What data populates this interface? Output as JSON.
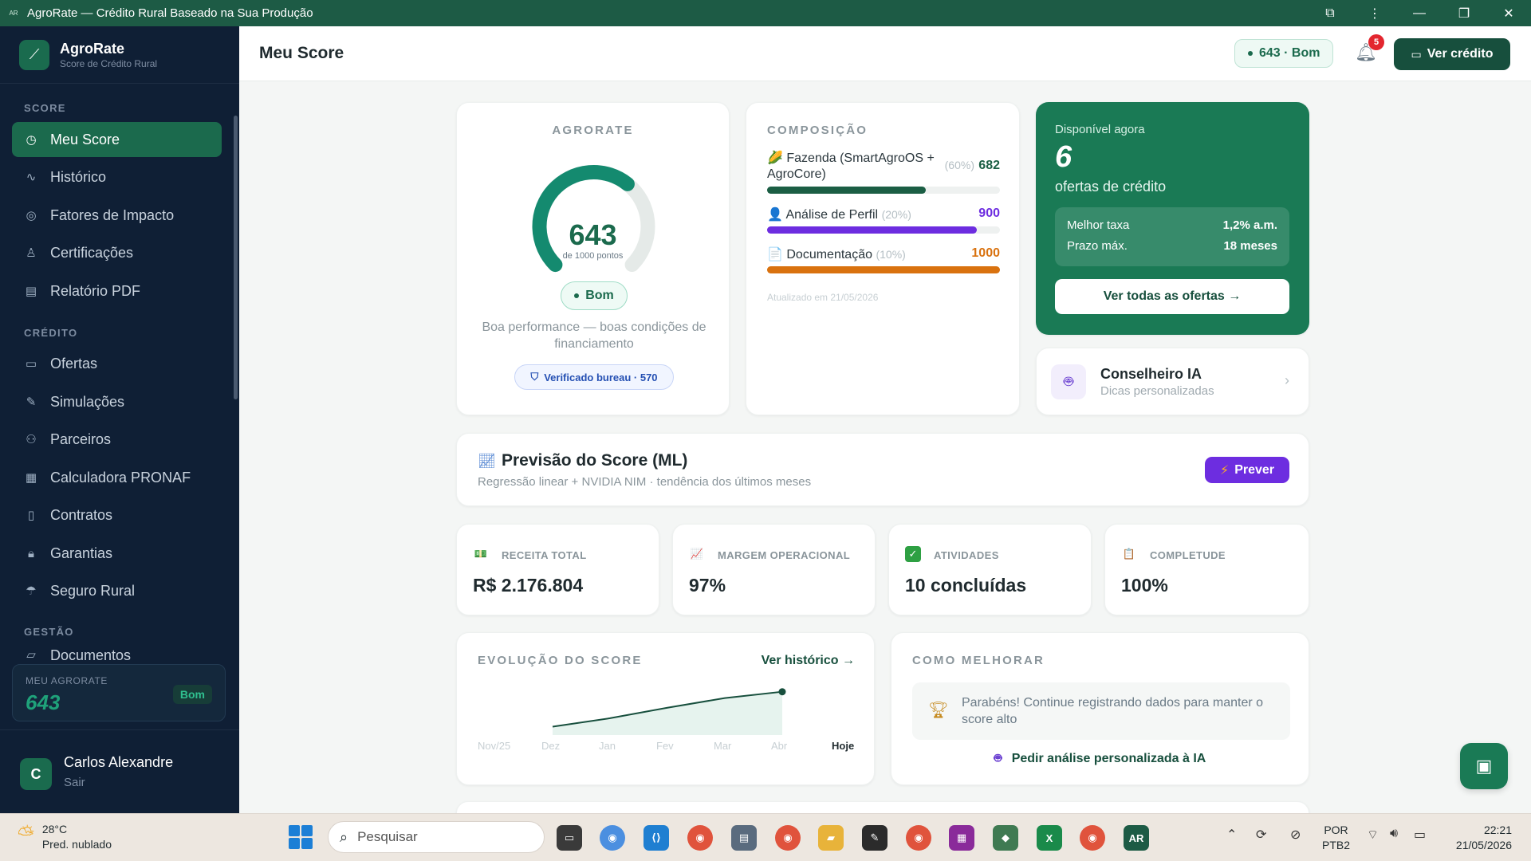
{
  "window": {
    "title": "AgroRate — Crédito Rural Baseado na Sua Produção",
    "app_icon": "AR"
  },
  "sidebar": {
    "brand_name": "AgroRate",
    "brand_sub": "Score de Crédito Rural",
    "sections": {
      "score": "SCORE",
      "credito": "CRÉDITO",
      "gestao": "GESTÃO"
    },
    "items": [
      {
        "label": "Meu Score",
        "icon": "gauge-icon"
      },
      {
        "label": "Histórico",
        "icon": "activity-icon"
      },
      {
        "label": "Fatores de Impacto",
        "icon": "target-icon"
      },
      {
        "label": "Certificações",
        "icon": "award-icon"
      },
      {
        "label": "Relatório PDF",
        "icon": "file-icon"
      },
      {
        "label": "Ofertas",
        "icon": "card-icon"
      },
      {
        "label": "Simulações",
        "icon": "edit-icon"
      },
      {
        "label": "Parceiros",
        "icon": "users-icon"
      },
      {
        "label": "Calculadora PRONAF",
        "icon": "calculator-icon"
      },
      {
        "label": "Contratos",
        "icon": "document-icon"
      },
      {
        "label": "Garantias",
        "icon": "lock-icon"
      },
      {
        "label": "Seguro Rural",
        "icon": "umbrella-icon"
      },
      {
        "label": "Documentos",
        "icon": "folder-icon"
      }
    ],
    "mini_score": {
      "label": "MEU AGRORATE",
      "value": "643",
      "badge": "Bom"
    },
    "user": {
      "initial": "C",
      "name": "Carlos Alexandre",
      "exit": "Sair"
    }
  },
  "header": {
    "title": "Meu Score",
    "score_pill": "643 · Bom",
    "notifications": "5",
    "cta": "Ver crédito"
  },
  "gauge": {
    "label": "AGRORATE",
    "value": "643",
    "max_text": "de 1000 pontos",
    "score_fraction": 0.643,
    "status": "Bom",
    "description": "Boa performance — boas condições de financiamento",
    "verified": "Verificado bureau · 570"
  },
  "composition": {
    "label": "COMPOSIÇÃO",
    "rows": [
      {
        "icon": "🌽",
        "label": "Fazenda (SmartAgroOS + AgroCore)",
        "pct": "(60%)",
        "value": "682",
        "fraction": 0.682,
        "color": "#1b5e44"
      },
      {
        "icon": "👤",
        "label": "Análise de Perfil",
        "pct": "(20%)",
        "value": "900",
        "fraction": 0.9,
        "color": "#6d2de0"
      },
      {
        "icon": "📄",
        "label": "Documentação",
        "pct": "(10%)",
        "value": "1000",
        "fraction": 1.0,
        "color": "#d9720f"
      }
    ],
    "updated": "Atualizado em 21/05/2026"
  },
  "offers": {
    "avail": "Disponível agora",
    "count": "6",
    "label": "ofertas de crédito",
    "best_rate_label": "Melhor taxa",
    "best_rate_value": "1,2% a.m.",
    "max_term_label": "Prazo máx.",
    "max_term_value": "18 meses",
    "button": "Ver todas as ofertas →"
  },
  "advisor": {
    "title": "Conselheiro IA",
    "subtitle": "Dicas personalizadas"
  },
  "forecast": {
    "title": "Previsão do Score (ML)",
    "subtitle": "Regressão linear + NVIDIA NIM · tendência dos últimos meses",
    "button": "Prever"
  },
  "metrics": [
    {
      "label": "RECEITA TOTAL",
      "value": "R$ 2.176.804",
      "icon": "💵",
      "color": "#2ea043"
    },
    {
      "label": "MARGEM OPERACIONAL",
      "value": "97%",
      "icon": "📈",
      "color": "#5f8fd4"
    },
    {
      "label": "ATIVIDADES",
      "value": "10 concluídas",
      "icon": "✓",
      "color": "#2ea043"
    },
    {
      "label": "COMPLETUDE",
      "value": "100%",
      "icon": "📋",
      "color": "#c2713a"
    }
  ],
  "evolution": {
    "label": "EVOLUÇÃO DO SCORE",
    "link": "Ver histórico →",
    "chart_data": {
      "type": "area",
      "title": "EVOLUÇÃO DO SCORE",
      "categories": [
        "Nov/25",
        "Dez",
        "Jan",
        "Fev",
        "Mar",
        "Abr",
        "Hoje"
      ],
      "values": [
        null,
        560,
        580,
        605,
        628,
        643,
        null
      ],
      "highlight_last": true
    }
  },
  "improve": {
    "label": "COMO MELHORAR",
    "tip": "Parabéns! Continue registrando dados para manter o score alto",
    "ai_link": "Pedir análise personalizada à IA"
  },
  "taskbar": {
    "weather_temp": "28°C",
    "weather_desc": "Pred. nublado",
    "search_placeholder": "Pesquisar",
    "lang_line1": "POR",
    "lang_line2": "PTB2",
    "time": "22:21",
    "date": "21/05/2026"
  }
}
